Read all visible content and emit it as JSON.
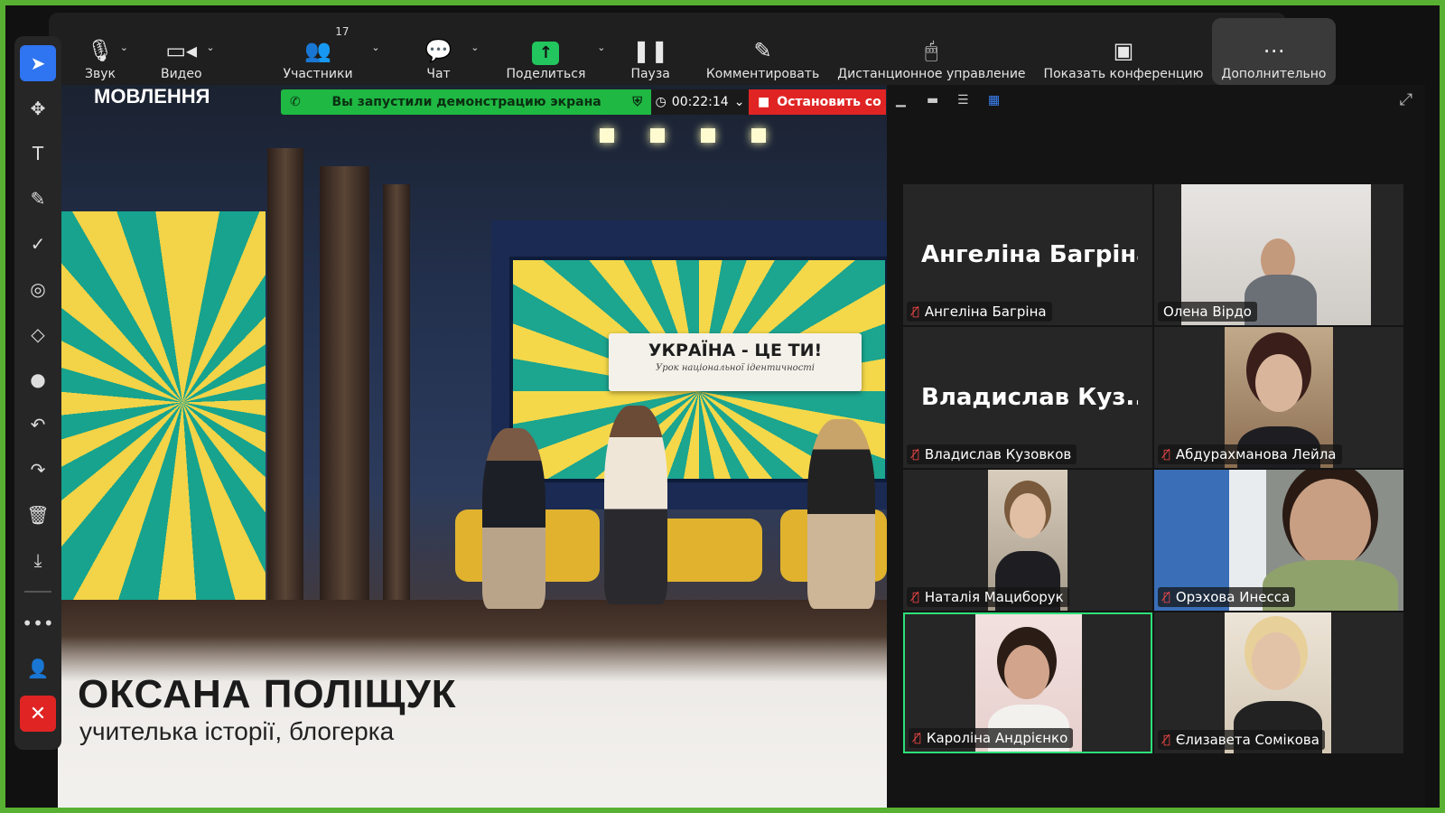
{
  "toolbar": {
    "audio": {
      "label": "Звук",
      "icon": "microphone-icon"
    },
    "video": {
      "label": "Видео",
      "icon": "camera-icon"
    },
    "participants": {
      "label": "Участники",
      "count": "17",
      "icon": "participants-icon"
    },
    "chat": {
      "label": "Чат",
      "icon": "chat-icon"
    },
    "share": {
      "label": "Поделиться",
      "icon": "share-screen-icon"
    },
    "pause": {
      "label": "Пауза",
      "icon": "pause-icon"
    },
    "annotate": {
      "label": "Комментировать",
      "icon": "pencil-icon"
    },
    "remote": {
      "label": "Дистанционное управление",
      "icon": "mouse-icon"
    },
    "show_meeting": {
      "label": "Показать конференцию",
      "icon": "meeting-window-icon"
    },
    "more": {
      "label": "Дополнительно",
      "icon": "more-icon"
    }
  },
  "share_bar": {
    "status": "Вы запустили демонстрацию экрана",
    "timer": "00:22:14",
    "stop_label": "Остановить со"
  },
  "shared_content": {
    "channel": "МОВЛЕННЯ",
    "card_title": "УКРАЇНА - ЦЕ ТИ!",
    "card_subtitle": "Урок національної ідентичності",
    "speaker_name": "ОКСАНА ПОЛІЩУК",
    "speaker_role": "учителька історії, блогерка"
  },
  "participants": [
    {
      "name": "Ангеліна Багріна",
      "display": "Ангеліна Багріна",
      "video": false,
      "muted": true
    },
    {
      "name": "Олена Вірдо",
      "video": true,
      "muted": false
    },
    {
      "name": "Владислав Кузовков",
      "display": "Владислав  Куз...",
      "video": false,
      "muted": true
    },
    {
      "name": "Абдурахманова Лейла",
      "video": true,
      "muted": true
    },
    {
      "name": "Наталія Мациборук",
      "video": true,
      "muted": true
    },
    {
      "name": "Орэхова Инесса",
      "video": true,
      "muted": true
    },
    {
      "name": "Кароліна Андрієнко",
      "video": true,
      "muted": true,
      "active": true
    },
    {
      "name": "Єлизавета Сомікова",
      "video": true,
      "muted": true
    }
  ],
  "colors": {
    "accent_green": "#1fb843",
    "stop_red": "#e02424",
    "active_tool": "#2f74f0",
    "active_speaker": "#2ee07a"
  }
}
